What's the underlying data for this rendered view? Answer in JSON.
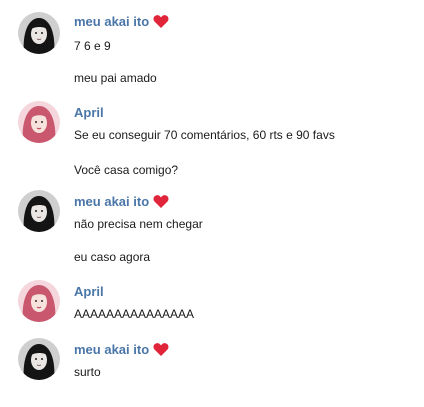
{
  "messages": [
    {
      "author": "meu akai ito",
      "avatar": "dark-hair-girl-avatar",
      "heart": true,
      "lines": [
        "7 6 e 9",
        "meu pai amado"
      ]
    },
    {
      "author": "April",
      "avatar": "pink-hair-girl-avatar",
      "heart": false,
      "lines": [
        "Se eu conseguir 70 comentários, 60 rts e 90 favs",
        "Você casa comigo?"
      ]
    },
    {
      "author": "meu akai ito",
      "avatar": "dark-hair-girl-avatar",
      "heart": true,
      "lines": [
        "não precisa nem chegar",
        "eu caso agora"
      ]
    },
    {
      "author": "April",
      "avatar": "pink-hair-girl-avatar",
      "heart": false,
      "lines": [
        "AAAAAAAAAAAAAAA"
      ]
    },
    {
      "author": "meu akai ito",
      "avatar": "dark-hair-girl-avatar",
      "heart": true,
      "lines": [
        "surto"
      ]
    }
  ],
  "colors": {
    "author_name": "#4a76a8",
    "text": "#1a1a1a",
    "heart": "#e0253a",
    "background": "#ffffff"
  }
}
